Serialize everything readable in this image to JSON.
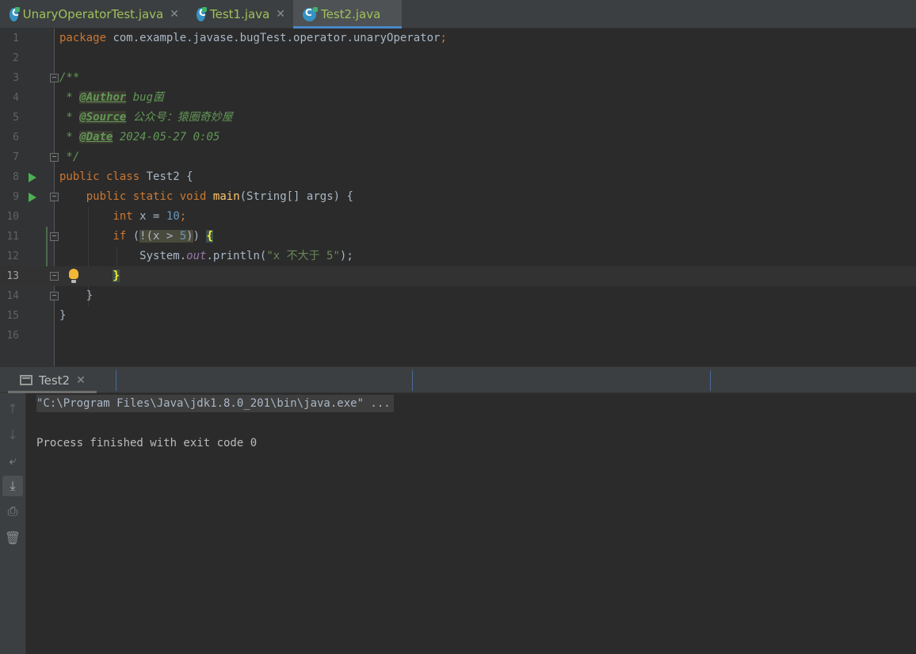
{
  "tabs": [
    {
      "label": "UnaryOperatorTest.java",
      "active": false
    },
    {
      "label": "Test1.java",
      "active": false
    },
    {
      "label": "Test2.java",
      "active": true
    }
  ],
  "editor": {
    "line_numbers": [
      "1",
      "2",
      "3",
      "4",
      "5",
      "6",
      "7",
      "8",
      "9",
      "10",
      "11",
      "12",
      "13",
      "14",
      "15",
      "16"
    ],
    "package_kw": "package",
    "package_name": " com.example.javase.bugTest.operator.unaryOperator",
    "semicolon": ";",
    "comment_open": "/**",
    "comment_star": " * ",
    "author_tag": "@Author",
    "author_value": " bug菌",
    "source_tag": "@Source",
    "source_value": " 公众号：猿圈奇妙屋",
    "date_tag": "@Date",
    "date_value": " 2024-05-27 0:05",
    "comment_close": " */",
    "public_kw": "public",
    "class_kw": " class",
    "class_name": " Test2 {",
    "static_kw": " static",
    "void_kw": " void",
    "main_name": "main",
    "main_params": "(String[] args) {",
    "int_kw": "int",
    "x_assign": " x = ",
    "ten": "10",
    "if_kw": "if",
    "if_open": " (",
    "if_cond": "!(x > ",
    "five": "5",
    "if_close_paren": ")",
    "if_close": ") ",
    "brace_open": "{",
    "system": "System.",
    "out": "out",
    "println": ".println(",
    "str_value": "\"x 不大于 5\"",
    "println_end": ");",
    "brace_close": "}",
    "method_close": "}",
    "class_close": "}"
  },
  "run": {
    "tab_label": "Test2",
    "cmd": "\"C:\\Program Files\\Java\\jdk1.8.0_201\\bin\\java.exe\" ...",
    "exit_msg": "Process finished with exit code 0"
  },
  "icons": {
    "toolbar": [
      "up-arrow-icon",
      "down-arrow-icon",
      "soft-wrap-icon",
      "scroll-to-end-icon",
      "print-icon",
      "trash-icon"
    ]
  },
  "colors": {
    "keyword": "#cc7832",
    "comment": "#629755",
    "number": "#6897bb",
    "string": "#6a8759",
    "tab_text": "#9fc15b",
    "active_tab_underline": "#4a88c7"
  }
}
